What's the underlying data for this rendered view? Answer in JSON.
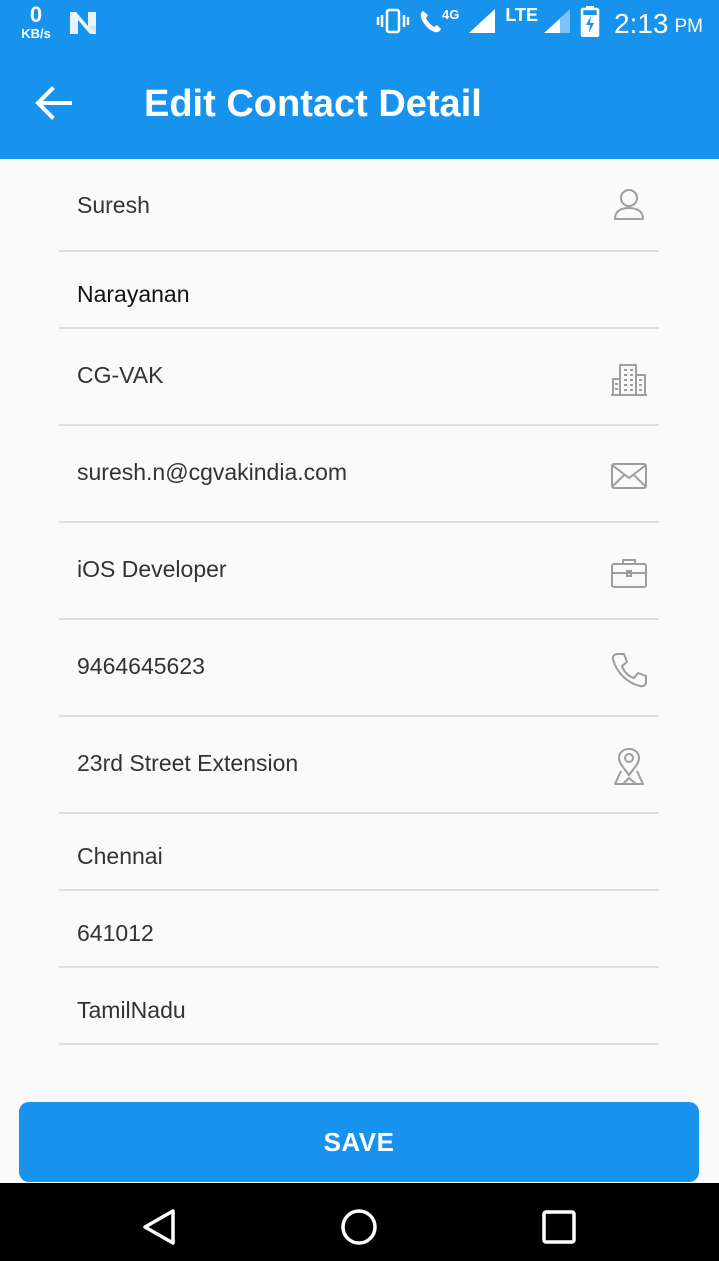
{
  "status_bar": {
    "speed_value": "0",
    "speed_unit": "KB/s",
    "network_4g": "4G",
    "network_lte": "LTE",
    "time": "2:13",
    "ampm": "PM",
    "icons": [
      "n-notification-icon",
      "vibrate-icon",
      "volte-call-icon",
      "signal-icon",
      "lte-signal-icon",
      "battery-charging-icon"
    ]
  },
  "app_bar": {
    "title": "Edit Contact Detail",
    "back_icon": "arrow-back-icon"
  },
  "form": {
    "first_name": "Suresh",
    "last_name": "Narayanan",
    "company": "CG-VAK",
    "email": "suresh.n@cgvakindia.com",
    "job_title": "iOS Developer",
    "phone": "9464645623",
    "street": "23rd Street Extension",
    "city": "Chennai",
    "zip": "641012",
    "state": "TamilNadu"
  },
  "save_button": {
    "label": "SAVE"
  },
  "colors": {
    "primary": "#1793ee",
    "divider": "#dedede",
    "icon": "#9e9e9e",
    "background": "#fafafa"
  },
  "nav_bar": {
    "icons": [
      "back-triangle-icon",
      "home-circle-icon",
      "recents-square-icon"
    ]
  }
}
